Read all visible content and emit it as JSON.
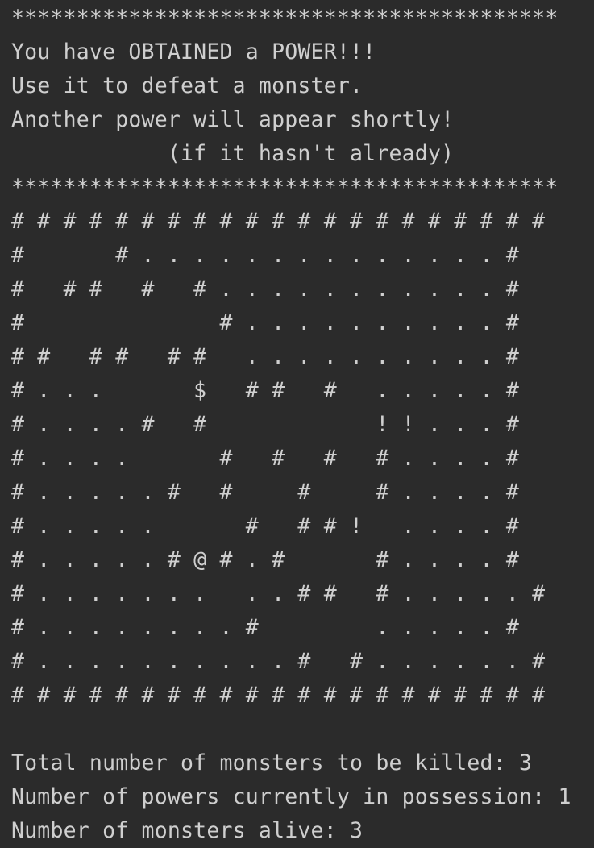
{
  "banner": {
    "top_border": "******************************************",
    "lines": [
      "You have OBTAINED a POWER!!!",
      "Use it to defeat a monster.",
      "Another power will appear shortly!",
      "            (if it hasn't already)"
    ],
    "bottom_border": "******************************************"
  },
  "grid": {
    "rows": [
      "# # # # # # # # # # # # # # # # # # # # #",
      "#       # . . . . . . . . . . . . . . #",
      "#   # #   #   # . . . . . . . . . . . #",
      "#               # . . . . . . . . . . #",
      "# #   # #   # #   . . . . . . . . . . #",
      "# . . .       $   # #   #   . . . . . #",
      "# . . . . #   #             ! ! . . . #",
      "# . . . .       #   #   #   # . . . . #",
      "# . . . . . #   #     #     # . . . . #",
      "# . . . . .       #   # # !   . . . . #",
      "# . . . . . # @ # . #       # . . . . #",
      "# . . . . . . .   . . # #   # . . . . . #",
      "# . . . . . . . . #         . . . . . #",
      "# . . . . . . . . . . #   # . . . . . . #",
      "# # # # # # # # # # # # # # # # # # # # #"
    ]
  },
  "status": {
    "monsters_to_kill": "Total number of monsters to be killed: 3",
    "powers_in_possession": "Number of powers currently in possession: 1",
    "monsters_alive": "Number of monsters alive: 3"
  },
  "colors": {
    "background": "#2b2b2b",
    "text": "#cfcfcf"
  }
}
